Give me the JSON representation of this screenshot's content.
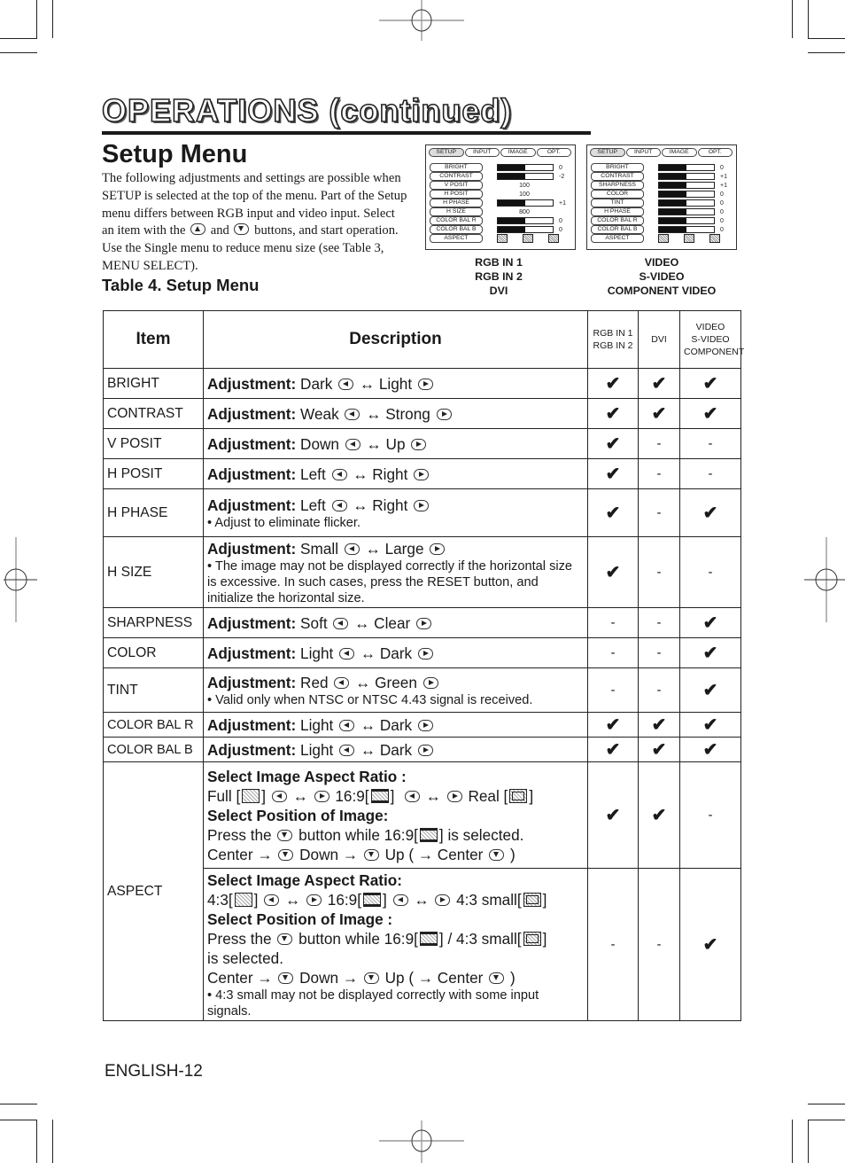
{
  "page": {
    "title": "OPERATIONS (continued)",
    "section_title": "Setup Menu",
    "intro_parts": [
      "The following adjustments and settings are possible when SETUP is selected at the top of the menu. Part of the Setup menu differs between RGB input and video input. Select an item with the",
      "and",
      "buttons, and start operation. Use the Single menu to reduce menu size (see Table 3, MENU SELECT)."
    ],
    "table_caption": "Table 4. Setup Menu",
    "footer": "ENGLISH-12"
  },
  "osd_rgb": {
    "tabs": [
      "SETUP",
      "INPUT",
      "IMAGE",
      "OPT."
    ],
    "rows": [
      {
        "label": "BRIGHT",
        "type": "bar",
        "fill": 0.5,
        "value": "0"
      },
      {
        "label": "CONTRAST",
        "type": "bar",
        "fill": 0.5,
        "value": "-2"
      },
      {
        "label": "V POSIT",
        "type": "num",
        "value": "100"
      },
      {
        "label": "H POSIT",
        "type": "num",
        "value": "100"
      },
      {
        "label": "H PHASE",
        "type": "bar",
        "fill": 0.5,
        "value": "+1"
      },
      {
        "label": "H SIZE",
        "type": "num",
        "value": "800"
      },
      {
        "label": "COLOR BAL R",
        "type": "bar",
        "fill": 0.5,
        "value": "0"
      },
      {
        "label": "COLOR BAL B",
        "type": "bar",
        "fill": 0.5,
        "value": "0"
      },
      {
        "label": "ASPECT",
        "type": "aspect",
        "value": ""
      }
    ],
    "caption": [
      "RGB IN 1",
      "RGB IN 2",
      "DVI"
    ]
  },
  "osd_video": {
    "tabs": [
      "SETUP",
      "INPUT",
      "IMAGE",
      "OPT."
    ],
    "rows": [
      {
        "label": "BRIGHT",
        "type": "bar",
        "fill": 0.5,
        "value": "0"
      },
      {
        "label": "CONTRAST",
        "type": "bar",
        "fill": 0.5,
        "value": "+1"
      },
      {
        "label": "SHARPNESS",
        "type": "bar",
        "fill": 0.5,
        "value": "+1"
      },
      {
        "label": "COLOR",
        "type": "bar",
        "fill": 0.5,
        "value": "0"
      },
      {
        "label": "TINT",
        "type": "bar",
        "fill": 0.5,
        "value": "0"
      },
      {
        "label": "H PHASE",
        "type": "bar",
        "fill": 0.5,
        "value": "0"
      },
      {
        "label": "COLOR BAL  R",
        "type": "bar",
        "fill": 0.5,
        "value": "0"
      },
      {
        "label": "COLOR BAL  B",
        "type": "bar",
        "fill": 0.5,
        "value": "0"
      },
      {
        "label": "ASPECT",
        "type": "aspect",
        "value": ""
      }
    ],
    "caption": [
      "VIDEO",
      "S-VIDEO",
      "COMPONENT VIDEO"
    ]
  },
  "table": {
    "headers": {
      "item": "Item",
      "description": "Description",
      "col_rgb": [
        "RGB IN 1",
        "RGB IN 2"
      ],
      "col_dvi": "DVI",
      "col_video": [
        "VIDEO",
        "S-VIDEO",
        "COMPONENT"
      ]
    },
    "adj_label": "Adjustment:",
    "check": "✔",
    "dash": "-",
    "rows": [
      {
        "item": "BRIGHT",
        "left": "Dark",
        "right": "Light",
        "note": "",
        "rgb": "✔",
        "dvi": "✔",
        "video": "✔"
      },
      {
        "item": "CONTRAST",
        "left": "Weak",
        "right": "Strong",
        "note": "",
        "rgb": "✔",
        "dvi": "✔",
        "video": "✔"
      },
      {
        "item": "V POSIT",
        "left": "Down",
        "right": "Up",
        "note": "",
        "rgb": "✔",
        "dvi": "-",
        "video": "-"
      },
      {
        "item": "H POSIT",
        "left": "Left",
        "right": "Right",
        "note": "",
        "rgb": "✔",
        "dvi": "-",
        "video": "-"
      },
      {
        "item": "H PHASE",
        "left": "Left",
        "right": "Right",
        "note": "• Adjust to eliminate flicker.",
        "rgb": "✔",
        "dvi": "-",
        "video": "✔"
      },
      {
        "item": "H SIZE",
        "left": "Small",
        "right": "Large",
        "note": "• The image may not be displayed correctly if the horizontal size is excessive. In such cases, press the RESET button, and initialize the horizontal size.",
        "rgb": "✔",
        "dvi": "-",
        "video": "-"
      },
      {
        "item": "SHARPNESS",
        "left": "Soft",
        "right": "Clear",
        "note": "",
        "rgb": "-",
        "dvi": "-",
        "video": "✔"
      },
      {
        "item": "COLOR",
        "left": "Light",
        "right": "Dark",
        "note": "",
        "rgb": "-",
        "dvi": "-",
        "video": "✔"
      },
      {
        "item": "TINT",
        "left": "Red",
        "right": "Green",
        "note": "• Valid only when NTSC or NTSC 4.43 signal is received.",
        "rgb": "-",
        "dvi": "-",
        "video": "✔"
      },
      {
        "item": "COLOR BAL R",
        "left": "Light",
        "right": "Dark",
        "note": "",
        "rgb": "✔",
        "dvi": "✔",
        "video": "✔"
      },
      {
        "item": "COLOR BAL B",
        "left": "Light",
        "right": "Dark",
        "note": "",
        "rgb": "✔",
        "dvi": "✔",
        "video": "✔"
      }
    ],
    "aspect": {
      "item": "ASPECT",
      "rgb_block": {
        "heading1": "Select Image Aspect Ratio :",
        "opt1": "Full [",
        "opt2": "16:9[",
        "opt3": "Real [",
        "heading2": "Select Position of Image:",
        "press": "Press the",
        "press2": "button while 16:9[",
        "press3": "] is selected.",
        "seq": [
          "Center →",
          "Down →",
          "Up ( → Center",
          ")"
        ],
        "rgb": "✔",
        "dvi": "✔",
        "video": "-"
      },
      "video_block": {
        "heading1": "Select Image Aspect Ratio:",
        "opt1": "4:3[",
        "opt2": "16:9[",
        "opt3": "4:3 small[",
        "heading2": "Select Position of Image :",
        "press": "Press the",
        "press2": "button while 16:9[",
        "press_mid": "] / 4:3 small[",
        "press3": "]",
        "press4": "is selected.",
        "seq": [
          "Center →",
          "Down →",
          "Up ( → Center",
          ")"
        ],
        "note": "• 4:3 small may not be displayed correctly with some input signals.",
        "rgb": "-",
        "dvi": "-",
        "video": "✔"
      }
    }
  }
}
